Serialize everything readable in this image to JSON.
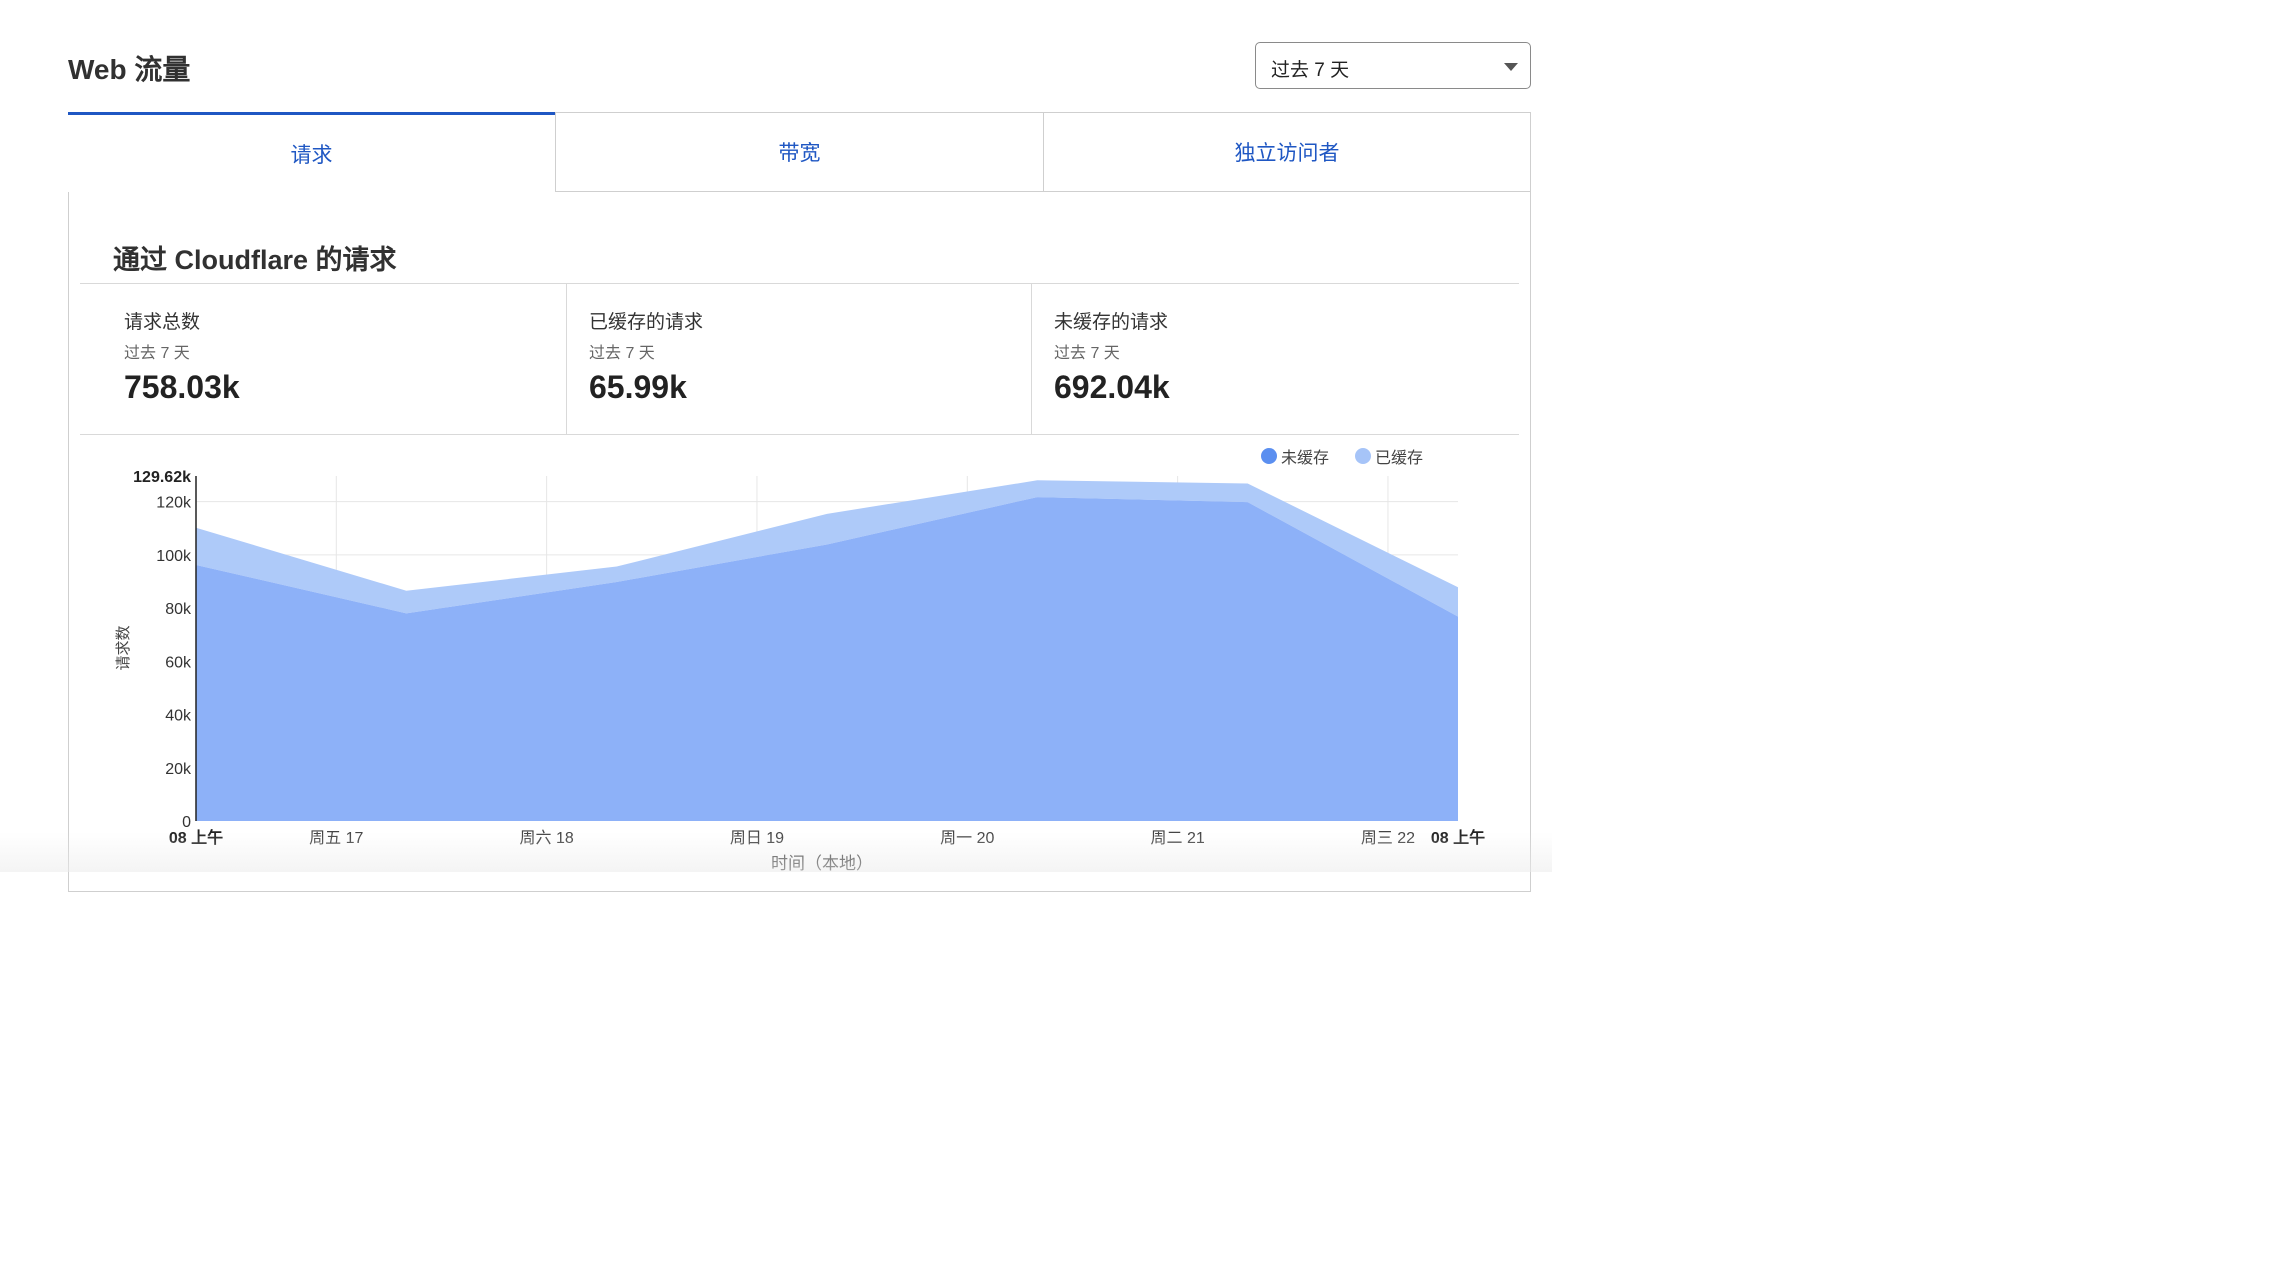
{
  "header": {
    "title": "Web 流量",
    "range_select": {
      "value": "过去 7 天"
    }
  },
  "tabs": [
    {
      "label": "请求",
      "active": true
    },
    {
      "label": "带宽",
      "active": false
    },
    {
      "label": "独立访问者",
      "active": false
    }
  ],
  "section": {
    "title": "通过 Cloudflare 的请求"
  },
  "stats": [
    {
      "label": "请求总数",
      "period": "过去 7 天",
      "value": "758.03k"
    },
    {
      "label": "已缓存的请求",
      "period": "过去 7 天",
      "value": "65.99k"
    },
    {
      "label": "未缓存的请求",
      "period": "过去 7 天",
      "value": "692.04k"
    }
  ],
  "colors": {
    "accent": "#1f57c3",
    "uncached": "#5b8ff0",
    "cached": "#a6c4f8",
    "uncached_area": "#8db1f8",
    "cached_area": "#aecaf9"
  },
  "chart_data": {
    "type": "area",
    "stacked": true,
    "xlabel": "时间（本地）",
    "ylabel": "请求数",
    "ylim": [
      0,
      129620
    ],
    "y_max_label": "129.62k",
    "y_ticks": [
      {
        "value": 0,
        "label": "0"
      },
      {
        "value": 20000,
        "label": "20k"
      },
      {
        "value": 40000,
        "label": "40k"
      },
      {
        "value": 60000,
        "label": "60k"
      },
      {
        "value": 80000,
        "label": "80k"
      },
      {
        "value": 100000,
        "label": "100k"
      },
      {
        "value": 120000,
        "label": "120k"
      }
    ],
    "x_ticks": [
      {
        "pos": 0,
        "label": "08 上午",
        "bold": true
      },
      {
        "pos": 0.667,
        "label": "周五 17",
        "bold": false
      },
      {
        "pos": 1.667,
        "label": "周六 18",
        "bold": false
      },
      {
        "pos": 2.667,
        "label": "周日 19",
        "bold": false
      },
      {
        "pos": 3.667,
        "label": "周一 20",
        "bold": false
      },
      {
        "pos": 4.667,
        "label": "周二 21",
        "bold": false
      },
      {
        "pos": 5.667,
        "label": "周三 22",
        "bold": false
      },
      {
        "pos": 6,
        "label": "08 上午",
        "bold": true
      }
    ],
    "legend": [
      {
        "name": "未缓存",
        "color": "#5b8ff0"
      },
      {
        "name": "已缓存",
        "color": "#a6c4f8"
      }
    ],
    "x": [
      0,
      1,
      2,
      3,
      4,
      5,
      6
    ],
    "series": [
      {
        "name": "未缓存",
        "values": [
          96200,
          78000,
          89800,
          103900,
          121700,
          119800,
          76800
        ]
      },
      {
        "name": "已缓存",
        "values": [
          14000,
          8500,
          5800,
          11500,
          6300,
          7000,
          11000
        ]
      }
    ]
  }
}
